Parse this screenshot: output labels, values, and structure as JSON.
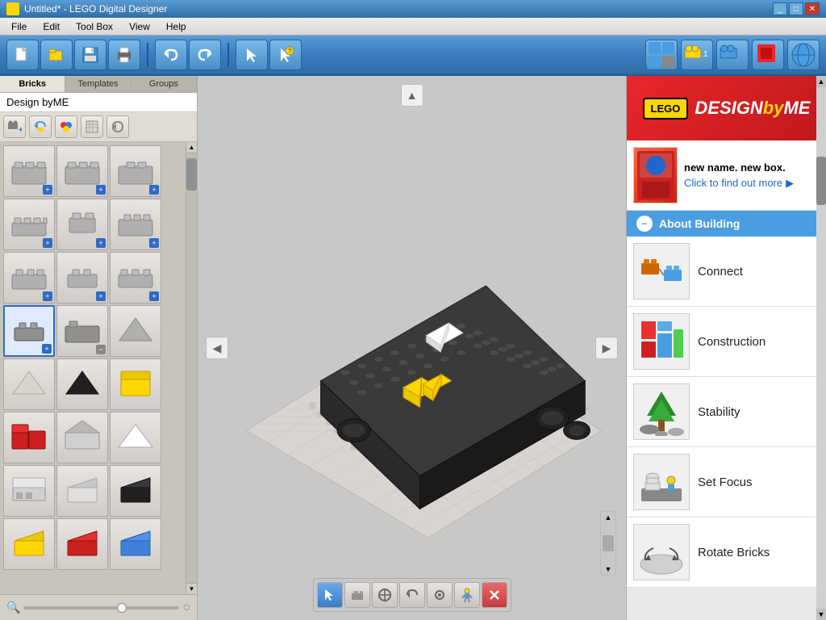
{
  "window": {
    "title": "Untitled* - LEGO Digital Designer",
    "controls": [
      "minimize",
      "restore",
      "close"
    ]
  },
  "menubar": {
    "items": [
      "File",
      "Edit",
      "Tool Box",
      "View",
      "Help"
    ]
  },
  "toolbar": {
    "left_buttons": [
      "new",
      "open",
      "save",
      "print",
      "undo",
      "redo"
    ],
    "right_buttons": [
      "select",
      "help",
      "help2"
    ],
    "far_right_buttons": [
      "build1",
      "build2",
      "build3",
      "view1",
      "globe"
    ]
  },
  "left_panel": {
    "tabs": [
      "Bricks",
      "Templates",
      "Groups"
    ],
    "active_tab": "Bricks",
    "design_label": "Design byME",
    "filter_buttons": [
      "plus",
      "rotate",
      "color",
      "texture",
      "refresh"
    ],
    "bricks": [
      {
        "row": 0,
        "cells": [
          {
            "id": "b1",
            "badge": "plus"
          },
          {
            "id": "b2",
            "badge": "plus"
          },
          {
            "id": "b3",
            "badge": "plus"
          }
        ]
      },
      {
        "row": 1,
        "cells": [
          {
            "id": "b4",
            "badge": "plus"
          },
          {
            "id": "b5",
            "badge": "plus"
          },
          {
            "id": "b6",
            "badge": "plus"
          }
        ]
      },
      {
        "row": 2,
        "cells": [
          {
            "id": "b7",
            "badge": "plus"
          },
          {
            "id": "b8",
            "badge": "plus"
          },
          {
            "id": "b9",
            "badge": "plus"
          }
        ]
      },
      {
        "row": 3,
        "cells": [
          {
            "id": "b10",
            "badge": "plus",
            "active": true
          },
          {
            "id": "b11",
            "badge": "minus"
          },
          {
            "id": "b12"
          }
        ]
      },
      {
        "row": 4,
        "cells": [
          {
            "id": "b13"
          },
          {
            "id": "b14"
          },
          {
            "id": "b15"
          }
        ]
      },
      {
        "row": 5,
        "cells": [
          {
            "id": "b16"
          },
          {
            "id": "b17"
          },
          {
            "id": "b18"
          }
        ]
      },
      {
        "row": 6,
        "cells": [
          {
            "id": "b19"
          },
          {
            "id": "b20"
          },
          {
            "id": "b21"
          }
        ]
      },
      {
        "row": 7,
        "cells": [
          {
            "id": "b22"
          },
          {
            "id": "b23"
          },
          {
            "id": "b24"
          }
        ]
      }
    ],
    "zoom": {
      "min": 0,
      "max": 100,
      "value": 60
    }
  },
  "canvas": {
    "tools": [
      "select",
      "place",
      "rotate",
      "paint",
      "examine",
      "smiley",
      "delete"
    ]
  },
  "right_panel": {
    "lego_logo": "LEGO",
    "designbyme": "DESIGNbyME",
    "promo": {
      "tagline": "new name. new box.",
      "link": "Click to find out more"
    },
    "about_building": {
      "label": "About Building",
      "items": [
        {
          "id": "connect",
          "label": "Connect"
        },
        {
          "id": "construction",
          "label": "Construction"
        },
        {
          "id": "stability",
          "label": "Stability"
        },
        {
          "id": "set_focus",
          "label": "Set Focus"
        },
        {
          "id": "rotate_bricks",
          "label": "Rotate Bricks"
        }
      ]
    }
  },
  "colors": {
    "accent_blue": "#4a9de0",
    "lego_red": "#e8272b",
    "lego_yellow": "#ffd700",
    "toolbar_blue": "#3a7bbf"
  }
}
